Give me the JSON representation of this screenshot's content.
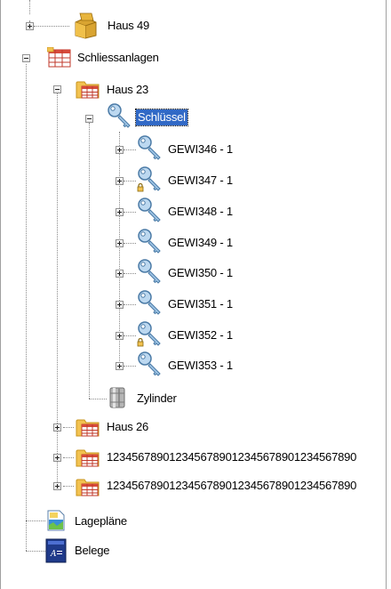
{
  "tree": {
    "haus49": {
      "label": "Haus 49",
      "icon": "box-icon",
      "expander": "plus"
    },
    "schliessanlagen": {
      "label": "Schliessanlagen",
      "icon": "table-icon",
      "expander": "minus"
    },
    "haus23": {
      "label": "Haus 23",
      "icon": "folder-table-icon",
      "expander": "minus"
    },
    "schluessel": {
      "label": "Schlüssel",
      "icon": "key-icon",
      "expander": "minus",
      "selected": true
    },
    "keys": [
      {
        "label": "GEWI346 - 1",
        "locked": false
      },
      {
        "label": "GEWI347 - 1",
        "locked": true
      },
      {
        "label": "GEWI348 - 1",
        "locked": false
      },
      {
        "label": "GEWI349 - 1",
        "locked": false
      },
      {
        "label": "GEWI350 - 1",
        "locked": false
      },
      {
        "label": "GEWI351 - 1",
        "locked": false
      },
      {
        "label": "GEWI352 - 1",
        "locked": true
      },
      {
        "label": "GEWI353 - 1",
        "locked": false
      }
    ],
    "zylinder": {
      "label": "Zylinder",
      "icon": "cylinder-icon"
    },
    "haus26": {
      "label": "Haus 26",
      "icon": "folder-table-icon",
      "expander": "plus"
    },
    "long1": {
      "label": "1234567890123456789012345678901234567890",
      "icon": "folder-table-icon",
      "expander": "plus"
    },
    "long2": {
      "label": "1234567890123456789012345678901234567890",
      "icon": "folder-table-icon",
      "expander": "plus"
    },
    "lageplaene": {
      "label": "Lagepläne",
      "icon": "map-document-icon"
    },
    "belege": {
      "label": "Belege",
      "icon": "receipt-icon"
    }
  },
  "colors": {
    "selection": "#3169c6",
    "folder": "#f2c250",
    "grid": "#c0392b",
    "key": "#6aa5d8"
  }
}
